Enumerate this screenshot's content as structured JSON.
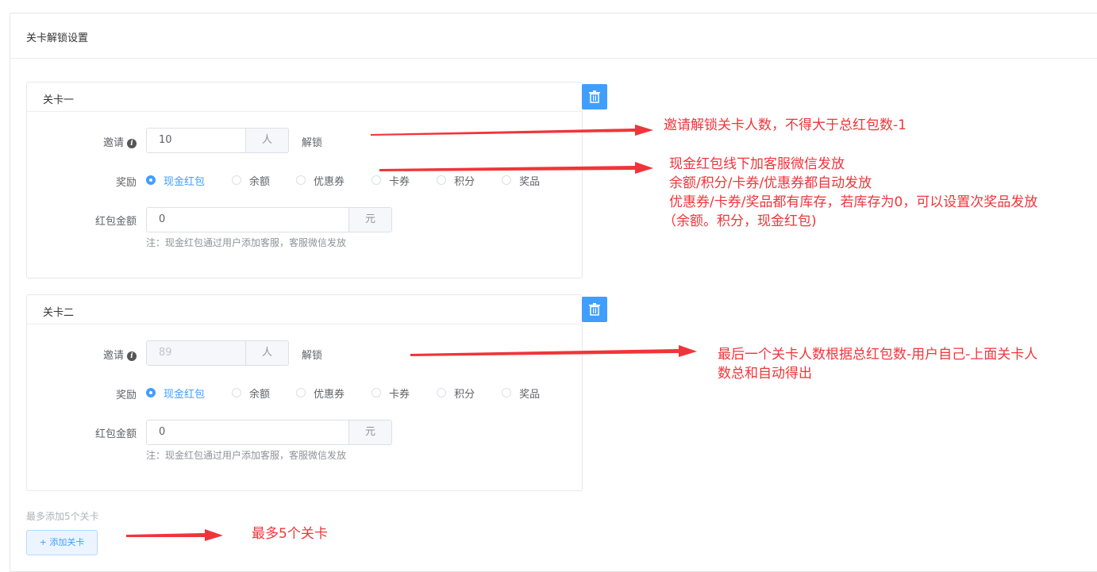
{
  "panel": {
    "title": "关卡解锁设置"
  },
  "levels": [
    {
      "title": "关卡一",
      "invite_label": "邀请",
      "invite_value": "10",
      "invite_unit": "人",
      "invite_suffix": "解锁",
      "reward_label": "奖励",
      "rewards": [
        "现金红包",
        "余额",
        "优惠券",
        "卡券",
        "积分",
        "奖品"
      ],
      "selected_reward": "现金红包",
      "amount_label": "红包金额",
      "amount_value": "0",
      "amount_unit": "元",
      "note": "注：现金红包通过用户添加客服，客服微信发放"
    },
    {
      "title": "关卡二",
      "invite_label": "邀请",
      "invite_value": "89",
      "invite_unit": "人",
      "invite_suffix": "解锁",
      "reward_label": "奖励",
      "rewards": [
        "现金红包",
        "余额",
        "优惠券",
        "卡券",
        "积分",
        "奖品"
      ],
      "selected_reward": "现金红包",
      "amount_label": "红包金额",
      "amount_value": "0",
      "amount_unit": "元",
      "note": "注：现金红包通过用户添加客服，客服微信发放"
    }
  ],
  "footer": {
    "hint": "最多添加5个关卡",
    "add_button": "+ 添加关卡"
  },
  "annotations": {
    "a1": "邀请解锁关卡人数，不得大于总红包数-1",
    "a2_lines": [
      "现金红包线下加客服微信发放",
      "余额/积分/卡券/优惠券都自动发放",
      "优惠券/卡券/奖品都有库存，若库存为0，可以设置次奖品发放",
      "（余额。积分，现金红包)"
    ],
    "a3_lines": [
      "最后一个关卡人数根据总红包数-用户自己-上面关卡人",
      "数总和自动得出"
    ],
    "a4": "最多5个关卡"
  },
  "colors": {
    "primary": "#409eff",
    "annotation": "#f0353a"
  }
}
